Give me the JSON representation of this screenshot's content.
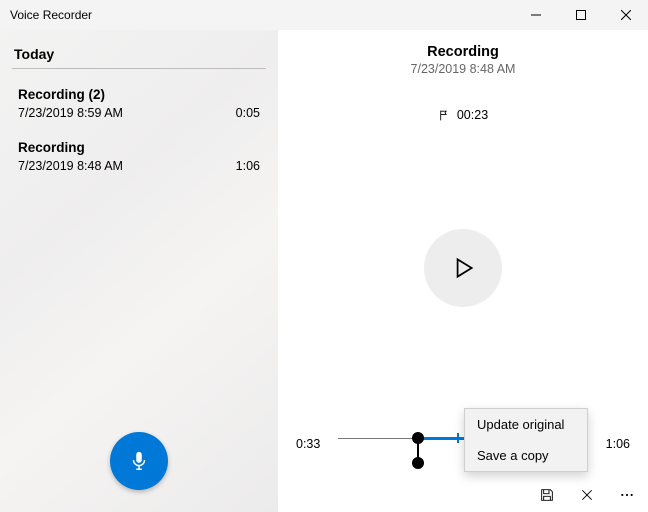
{
  "window": {
    "title": "Voice Recorder"
  },
  "sidebar": {
    "section": "Today",
    "items": [
      {
        "title": "Recording (2)",
        "datetime": "7/23/2019 8:59 AM",
        "duration": "0:05"
      },
      {
        "title": "Recording",
        "datetime": "7/23/2019 8:48 AM",
        "duration": "1:06"
      }
    ]
  },
  "main": {
    "title": "Recording",
    "subtitle": "7/23/2019 8:48 AM",
    "marker_time": "00:23",
    "timeline": {
      "start": "0:33",
      "end": "1:06"
    },
    "popup": {
      "update": "Update original",
      "save_copy": "Save a copy"
    }
  }
}
